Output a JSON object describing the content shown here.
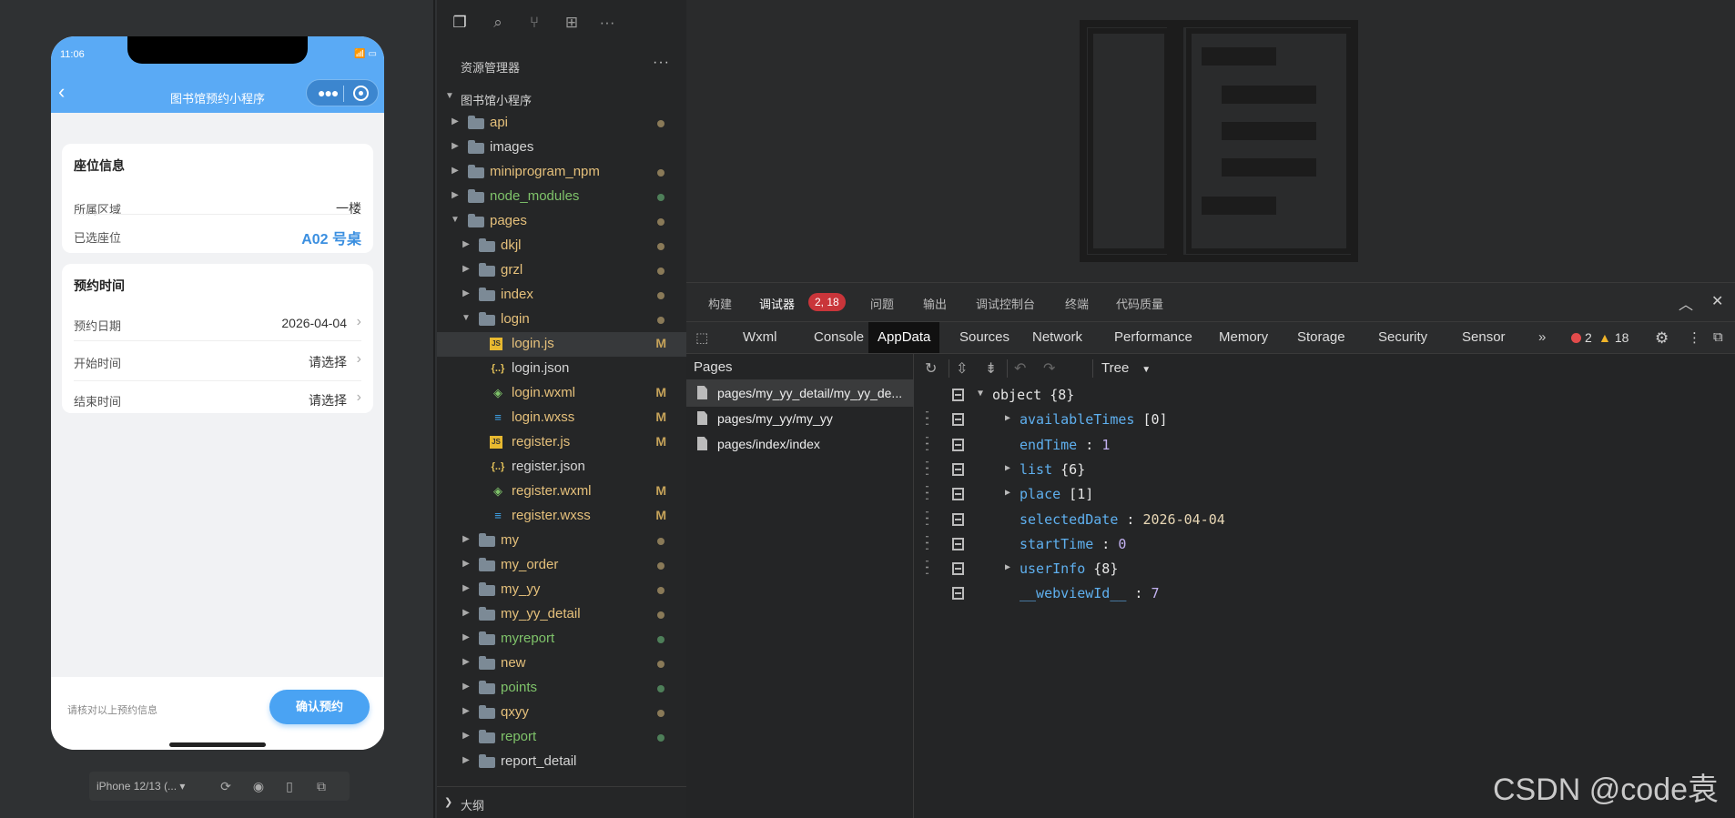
{
  "simulator": {
    "time": "11:06",
    "nav_title": "图书馆预约小程序",
    "seat_card": {
      "title": "座位信息",
      "rows": [
        {
          "label": "所属区域",
          "value": "一楼"
        },
        {
          "label": "已选座位",
          "value": "A02 号桌"
        }
      ]
    },
    "time_card": {
      "title": "预约时间",
      "rows": [
        {
          "label": "预约日期",
          "value": "2026-04-04"
        },
        {
          "label": "开始时间",
          "value": "请选择"
        },
        {
          "label": "结束时间",
          "value": "请选择"
        }
      ]
    },
    "footer_hint": "请核对以上预约信息",
    "confirm_label": "确认预约",
    "device_label": "iPhone 12/13 (..."
  },
  "explorer": {
    "header": "资源管理器",
    "root": "图书馆小程序",
    "items": [
      {
        "name": "api",
        "type": "folder",
        "depth": 1,
        "color": "#e5c07b",
        "mark": "dot"
      },
      {
        "name": "images",
        "type": "folder",
        "depth": 1,
        "color": "#d4d4d4",
        "mark": ""
      },
      {
        "name": "miniprogram_npm",
        "type": "folder",
        "depth": 1,
        "color": "#e5c07b",
        "mark": "dot"
      },
      {
        "name": "node_modules",
        "type": "folder",
        "depth": 1,
        "color": "#7fc36a",
        "mark": "green"
      },
      {
        "name": "pages",
        "type": "folder",
        "depth": 1,
        "color": "#e5c07b",
        "mark": "dot",
        "open": true
      },
      {
        "name": "dkjl",
        "type": "folder",
        "depth": 2,
        "color": "#e5c07b",
        "mark": "dot"
      },
      {
        "name": "grzl",
        "type": "folder",
        "depth": 2,
        "color": "#e5c07b",
        "mark": "dot"
      },
      {
        "name": "index",
        "type": "folder",
        "depth": 2,
        "color": "#e5c07b",
        "mark": "dot"
      },
      {
        "name": "login",
        "type": "folder",
        "depth": 2,
        "color": "#e5c07b",
        "mark": "dot",
        "open": true
      },
      {
        "name": "login.js",
        "type": "js",
        "depth": 3,
        "color": "#e5c07b",
        "mark": "M",
        "selected": true
      },
      {
        "name": "login.json",
        "type": "json",
        "depth": 3,
        "color": "#d4d4d4",
        "mark": ""
      },
      {
        "name": "login.wxml",
        "type": "wxml",
        "depth": 3,
        "color": "#e5c07b",
        "mark": "M"
      },
      {
        "name": "login.wxss",
        "type": "wxss",
        "depth": 3,
        "color": "#e5c07b",
        "mark": "M"
      },
      {
        "name": "register.js",
        "type": "js",
        "depth": 3,
        "color": "#e5c07b",
        "mark": "M"
      },
      {
        "name": "register.json",
        "type": "json",
        "depth": 3,
        "color": "#d4d4d4",
        "mark": ""
      },
      {
        "name": "register.wxml",
        "type": "wxml",
        "depth": 3,
        "color": "#e5c07b",
        "mark": "M"
      },
      {
        "name": "register.wxss",
        "type": "wxss",
        "depth": 3,
        "color": "#e5c07b",
        "mark": "M"
      },
      {
        "name": "my",
        "type": "folder",
        "depth": 2,
        "color": "#e5c07b",
        "mark": "dot"
      },
      {
        "name": "my_order",
        "type": "folder",
        "depth": 2,
        "color": "#e5c07b",
        "mark": "dot"
      },
      {
        "name": "my_yy",
        "type": "folder",
        "depth": 2,
        "color": "#e5c07b",
        "mark": "dot"
      },
      {
        "name": "my_yy_detail",
        "type": "folder",
        "depth": 2,
        "color": "#e5c07b",
        "mark": "dot"
      },
      {
        "name": "myreport",
        "type": "folder",
        "depth": 2,
        "color": "#7fc36a",
        "mark": "green"
      },
      {
        "name": "new",
        "type": "folder",
        "depth": 2,
        "color": "#e5c07b",
        "mark": "dot"
      },
      {
        "name": "points",
        "type": "folder",
        "depth": 2,
        "color": "#7fc36a",
        "mark": "green"
      },
      {
        "name": "qxyy",
        "type": "folder",
        "depth": 2,
        "color": "#e5c07b",
        "mark": "dot"
      },
      {
        "name": "report",
        "type": "folder",
        "depth": 2,
        "color": "#7fc36a",
        "mark": "green"
      },
      {
        "name": "report_detail",
        "type": "folder",
        "depth": 2,
        "color": "#d4d4d4",
        "mark": ""
      }
    ],
    "outline": "大纲"
  },
  "devtools": {
    "tabs": [
      "构建",
      "调试器",
      "问题",
      "输出",
      "调试控制台",
      "终端",
      "代码质量"
    ],
    "debugger_badge": "2, 18",
    "subtabs": [
      "Wxml",
      "Console",
      "AppData",
      "Sources",
      "Network",
      "Performance",
      "Memory",
      "Storage",
      "Security",
      "Sensor"
    ],
    "active_subtab": "AppData",
    "errors": "2",
    "warnings": "18",
    "pages_title": "Pages",
    "pages": [
      "pages/my_yy_detail/my_yy_de...",
      "pages/my_yy/my_yy",
      "pages/index/index"
    ],
    "view_mode": "Tree",
    "root_label": "object {8}",
    "nodes": [
      {
        "key": "availableTimes",
        "summary": "[0]",
        "expandable": true
      },
      {
        "key": "endTime",
        "value": "1",
        "kind": "num"
      },
      {
        "key": "list",
        "summary": "{6}",
        "expandable": true
      },
      {
        "key": "place",
        "summary": "[1]",
        "expandable": true
      },
      {
        "key": "selectedDate",
        "value": "2026-04-04",
        "kind": "str"
      },
      {
        "key": "startTime",
        "value": "0",
        "kind": "num"
      },
      {
        "key": "userInfo",
        "summary": "{8}",
        "expandable": true
      },
      {
        "key": "__webviewId__",
        "value": "7",
        "kind": "num"
      }
    ]
  },
  "watermark": "CSDN @code袁",
  "colors": {
    "brand_blue": "#5aaaf5",
    "confirm_blue": "#4aa3f3",
    "error_red": "#c9353a"
  }
}
